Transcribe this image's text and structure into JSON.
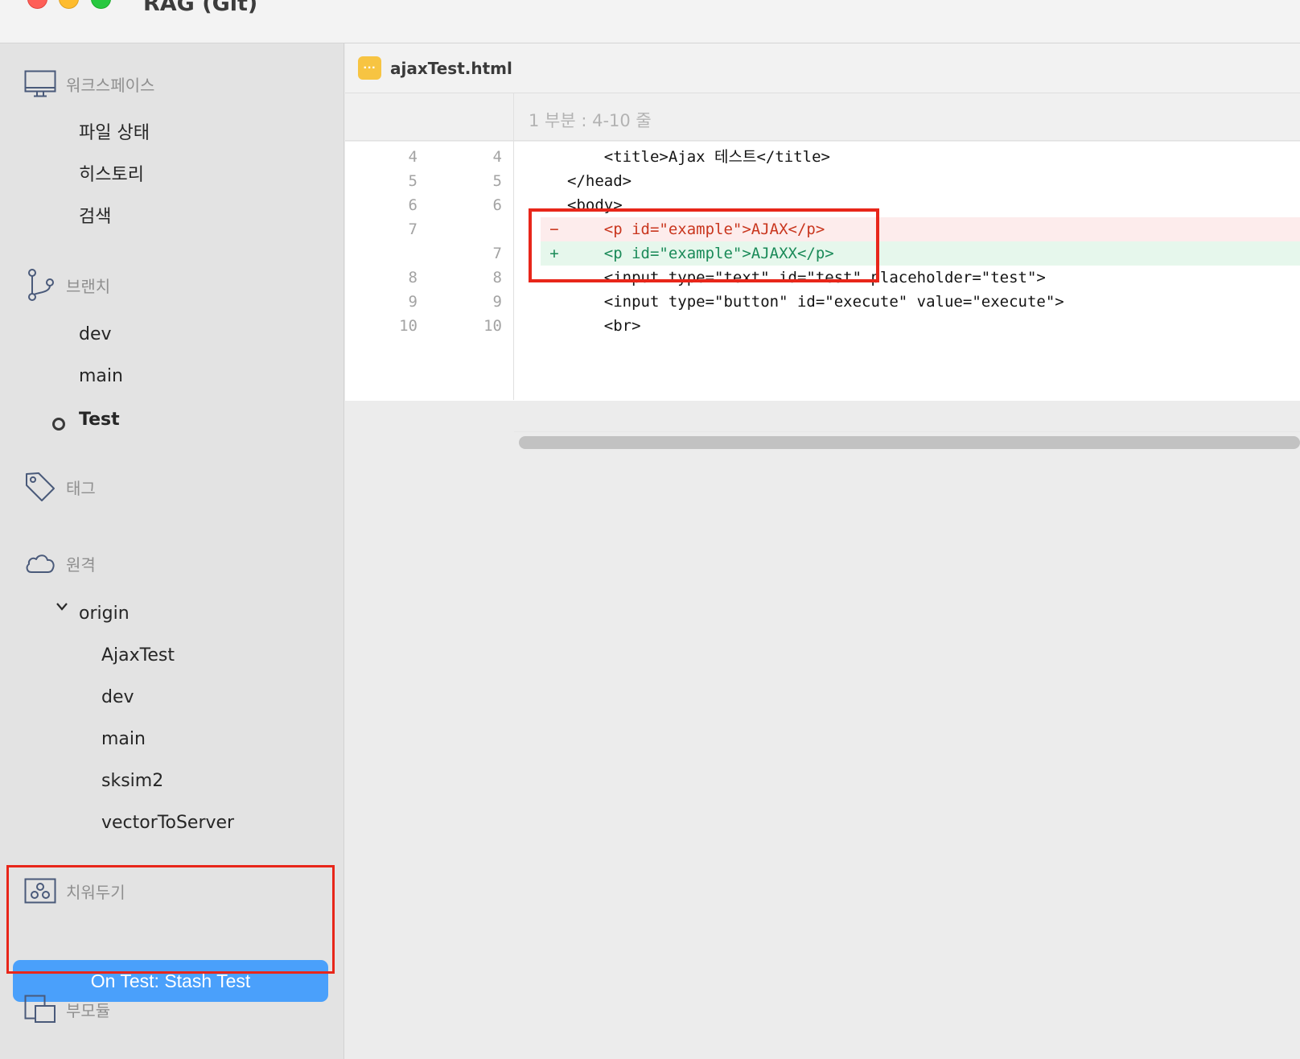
{
  "window": {
    "title": "RAG (Git)"
  },
  "sidebar": {
    "workspace": {
      "title": "워크스페이스",
      "items": [
        "파일 상태",
        "히스토리",
        "검색"
      ]
    },
    "branches": {
      "title": "브랜치",
      "items": [
        "dev",
        "main",
        "Test"
      ],
      "current": "Test"
    },
    "tags": {
      "title": "태그"
    },
    "remotes": {
      "title": "원격",
      "remote_name": "origin",
      "items": [
        "AjaxTest",
        "dev",
        "main",
        "sksim2",
        "vectorToServer"
      ]
    },
    "stashes": {
      "title": "치워두기",
      "items": [
        "On Test: Stash Test"
      ],
      "selected": "On Test: Stash Test"
    },
    "submodules": {
      "title": "부모듈"
    }
  },
  "file": {
    "name": "ajaxTest.html",
    "icon": "dots-icon"
  },
  "hunk": {
    "title": "1 부분 : 4-10 줄"
  },
  "diff_lines": [
    {
      "old": "4",
      "new": "4",
      "type": "ctx",
      "mark": "",
      "text": "    <title>Ajax 테스트</title>"
    },
    {
      "old": "5",
      "new": "5",
      "type": "ctx",
      "mark": "",
      "text": "</head>"
    },
    {
      "old": "6",
      "new": "6",
      "type": "ctx",
      "mark": "",
      "text": "<body>"
    },
    {
      "old": "7",
      "new": "",
      "type": "del",
      "mark": "−",
      "text": "    <p id=\"example\">AJAX</p>"
    },
    {
      "old": "",
      "new": "7",
      "type": "add",
      "mark": "+",
      "text": "    <p id=\"example\">AJAXX</p>"
    },
    {
      "old": "8",
      "new": "8",
      "type": "ctx",
      "mark": "",
      "text": "    <input type=\"text\" id=\"test\" placeholder=\"test\">"
    },
    {
      "old": "9",
      "new": "9",
      "type": "ctx",
      "mark": "",
      "text": "    <input type=\"button\" id=\"execute\" value=\"execute\">"
    },
    {
      "old": "10",
      "new": "10",
      "type": "ctx",
      "mark": "",
      "text": "    <br>"
    }
  ],
  "colors": {
    "accent": "#4aa0fb",
    "highlight_box": "#e8261a",
    "deleted": "#c9361e",
    "added": "#1a8a58"
  }
}
